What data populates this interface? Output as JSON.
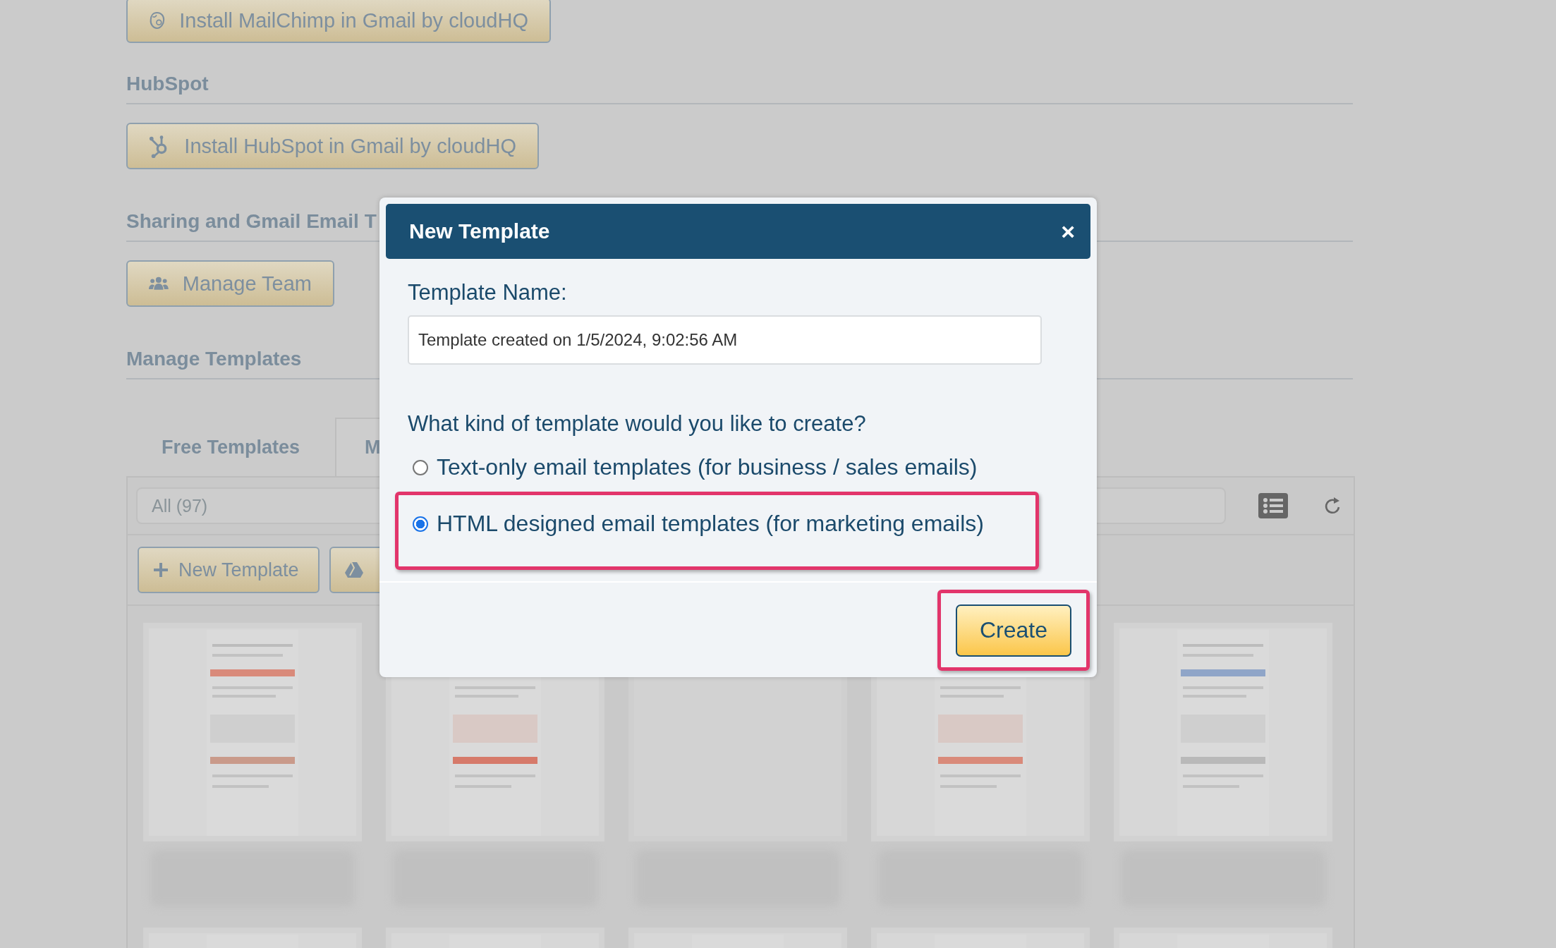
{
  "page": {
    "mailchimp_button": {
      "label": "Install MailChimp in Gmail by cloudHQ"
    },
    "hubspot_section": {
      "heading": "HubSpot",
      "button": "Install HubSpot in Gmail by cloudHQ"
    },
    "sharing_section": {
      "heading": "Sharing and Gmail Email T",
      "button": "Manage Team"
    },
    "templates_section": {
      "heading": "Manage Templates",
      "tabs": [
        {
          "label": "Free Templates",
          "selected": false
        },
        {
          "label": "M",
          "selected": true
        }
      ],
      "filter": {
        "value": "All (97)"
      },
      "new_template_button": "New Template",
      "template_cards": [
        {
          "kind": "picture"
        },
        {
          "kind": "picture"
        },
        {
          "kind": "blank"
        },
        {
          "kind": "picture"
        },
        {
          "kind": "picture"
        },
        {
          "kind": "picture"
        },
        {
          "kind": "picture"
        },
        {
          "kind": "picture"
        },
        {
          "kind": "picture"
        },
        {
          "kind": "picture"
        }
      ]
    }
  },
  "dialog": {
    "title": "New Template",
    "close": "×",
    "name_label": "Template Name:",
    "name_value": "Template created on 1/5/2024, 9:02:56 AM",
    "question": "What kind of template would you like to create?",
    "options": [
      {
        "label": "Text-only email templates (for business / sales emails)",
        "selected": false,
        "highlighted": false
      },
      {
        "label": "HTML designed email templates (for marketing emails)",
        "selected": true,
        "highlighted": true
      }
    ],
    "create_button": {
      "label": "Create",
      "highlighted": true
    }
  }
}
